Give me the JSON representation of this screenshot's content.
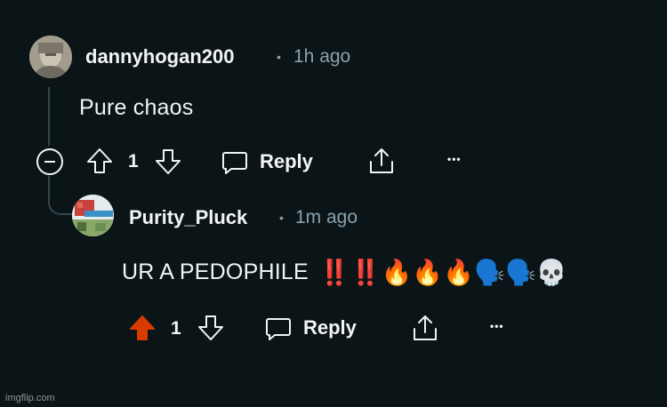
{
  "comments": [
    {
      "username": "dannyhogan200",
      "separator": "•",
      "time": "1h ago",
      "text": "Pure chaos",
      "votes": "1",
      "reply_label": "Reply",
      "more_label": "•••",
      "upvoted": false
    },
    {
      "username": "Purity_Pluck",
      "separator": "•",
      "time": "1m ago",
      "text": "UR A PEDOPHILE",
      "emoji": "‼️‼️🔥🔥🔥🗣️🗣️💀",
      "votes": "1",
      "reply_label": "Reply",
      "more_label": "•••",
      "upvoted": true
    }
  ],
  "watermark": "imgflip.com",
  "colors": {
    "background": "#0b1416",
    "text": "#f2f4f5",
    "muted": "#8ba2ad",
    "thread_line": "#33464c",
    "upvote_active": "#d93a00"
  },
  "icons": {
    "collapse": "minus-circle-icon",
    "upvote": "arrow-up-icon",
    "downvote": "arrow-down-icon",
    "reply": "chat-bubble-icon",
    "share": "share-icon",
    "more": "ellipsis-icon"
  }
}
